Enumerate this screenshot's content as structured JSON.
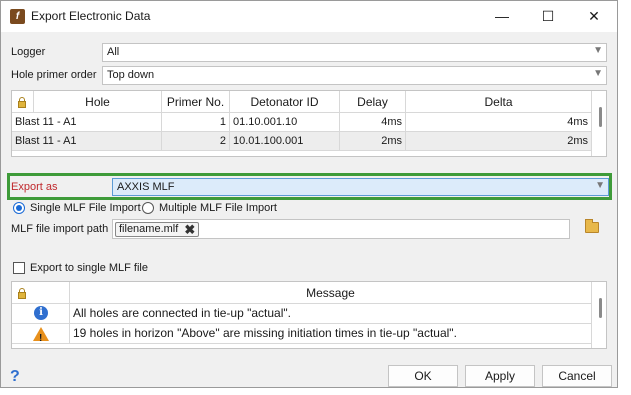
{
  "window": {
    "title": "Export Electronic Data",
    "minimize": "—",
    "maximize": "☐",
    "close": "✕"
  },
  "logger": {
    "label": "Logger",
    "value": "All"
  },
  "hole_primer_order": {
    "label": "Hole primer order",
    "value": "Top down"
  },
  "holes_table": {
    "columns": [
      "Hole",
      "Primer No.",
      "Detonator ID",
      "Delay",
      "Delta"
    ],
    "rows": [
      {
        "hole": "Blast 11 - A1",
        "primer": "1",
        "detonator": "01.10.001.10",
        "delay": "4ms",
        "delta": "4ms"
      },
      {
        "hole": "Blast 11 - A1",
        "primer": "2",
        "detonator": "10.01.100.001",
        "delay": "2ms",
        "delta": "2ms"
      }
    ]
  },
  "export_as": {
    "label": "Export as",
    "value": "AXXIS MLF"
  },
  "import_mode": {
    "single": "Single MLF File Import",
    "multiple": "Multiple MLF File Import"
  },
  "mlf_path": {
    "label": "MLF file import path",
    "file": "filename.mlf"
  },
  "export_single": {
    "label": "Export to single MLF file"
  },
  "messages_table": {
    "column": "Message",
    "rows": [
      {
        "icon": "info-icon",
        "text": "All holes are connected in tie-up \"actual\"."
      },
      {
        "icon": "warning-icon",
        "text": "19 holes in horizon \"Above\" are missing initiation times in tie-up \"actual\"."
      }
    ]
  },
  "buttons": {
    "ok": "OK",
    "apply": "Apply",
    "cancel": "Cancel",
    "help": "?"
  },
  "colors": {
    "highlight": "#3e9b39",
    "export_label": "#c0282c",
    "selected_combo": "#dcebfa"
  }
}
